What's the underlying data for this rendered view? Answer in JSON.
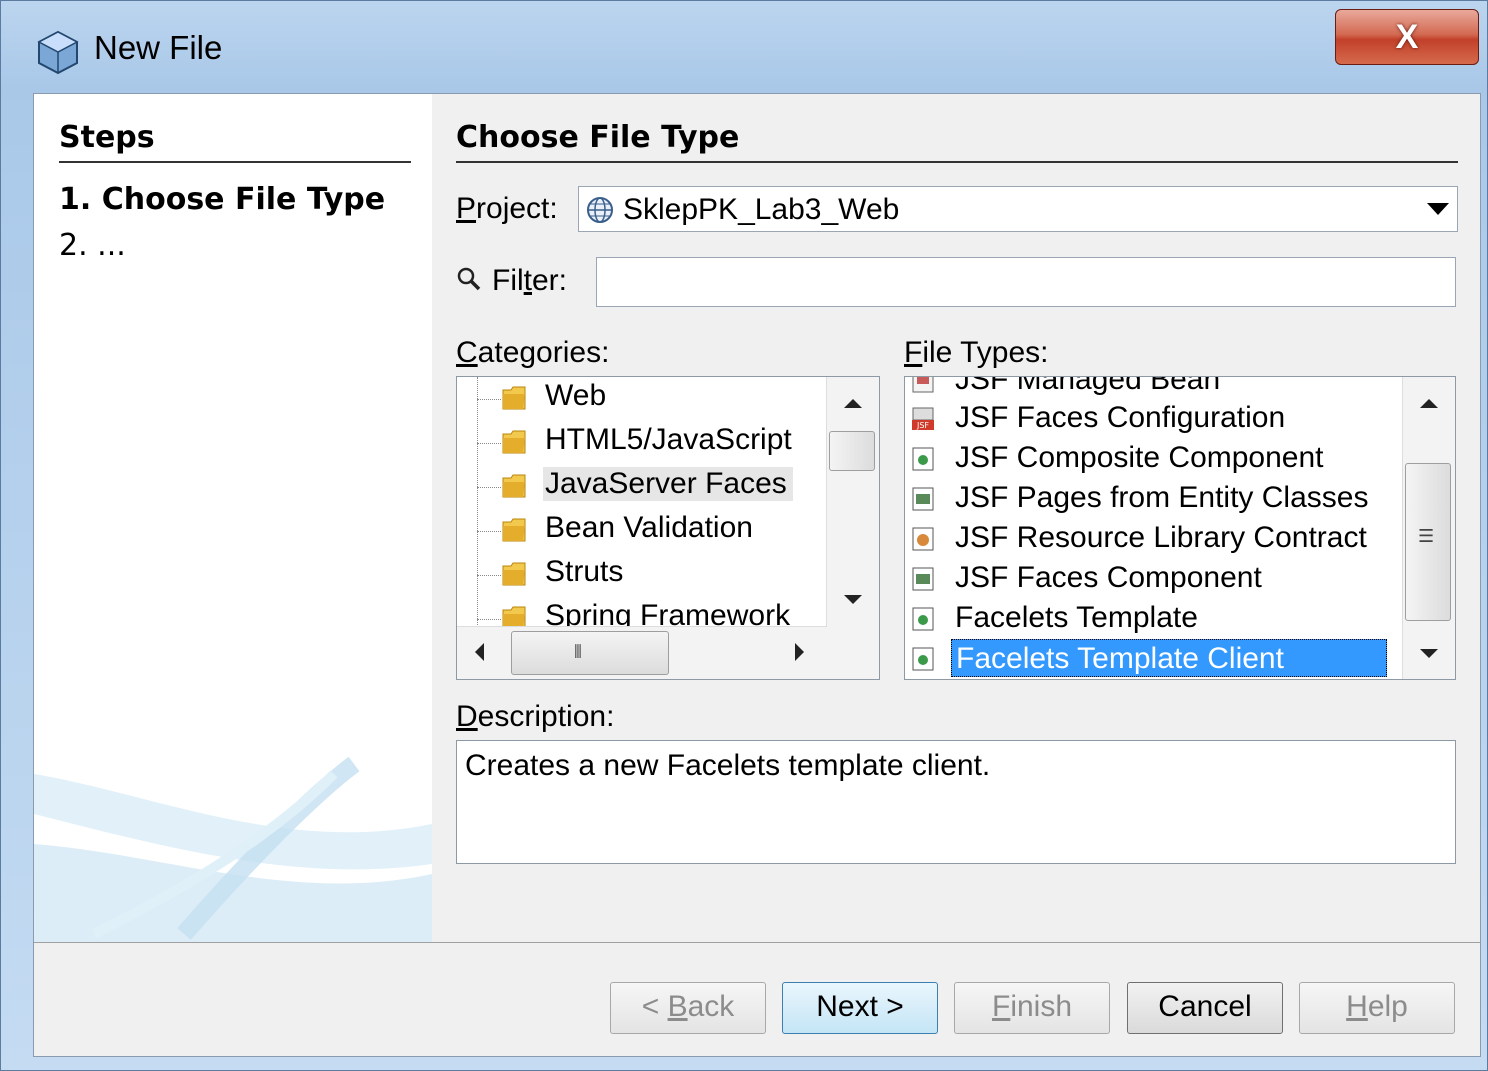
{
  "window": {
    "title": "New File",
    "close_label": "X"
  },
  "steps": {
    "heading": "Steps",
    "items": [
      {
        "num": "1.",
        "label": "Choose File Type"
      },
      {
        "num": "2.",
        "label": "..."
      }
    ]
  },
  "main": {
    "title": "Choose File Type",
    "project": {
      "label_prefix": "",
      "label_mnemonic": "P",
      "label_rest": "roject:",
      "value": "SklepPK_Lab3_Web"
    },
    "filter": {
      "label_pre": "Fil",
      "label_mnemonic": "t",
      "label_rest": "er:",
      "value": ""
    },
    "categories": {
      "label_mnemonic": "C",
      "label_rest": "ategories:",
      "items": [
        "Web",
        "HTML5/JavaScript",
        "JavaServer Faces",
        "Bean Validation",
        "Struts",
        "Spring Framework"
      ],
      "selected": "JavaServer Faces"
    },
    "file_types": {
      "label_mnemonic": "F",
      "label_rest": "ile Types:",
      "items": [
        "JSF Managed Bean",
        "JSF Faces Configuration",
        "JSF Composite Component",
        "JSF Pages from Entity Classes",
        "JSF Resource Library Contract",
        "JSF Faces Component",
        "Facelets Template",
        "Facelets Template Client"
      ],
      "selected": "Facelets Template Client"
    },
    "description": {
      "label_mnemonic": "D",
      "label_rest": "escription:",
      "text": "Creates a new Facelets template client."
    }
  },
  "buttons": {
    "back": {
      "pre": "< ",
      "mnemonic": "B",
      "rest": "ack"
    },
    "next": "Next >",
    "finish": {
      "mnemonic": "F",
      "rest": "inish"
    },
    "cancel": "Cancel",
    "help": {
      "mnemonic": "H",
      "rest": "elp"
    }
  },
  "colors": {
    "selection": "#3399ff",
    "title_bar": "#bcd5ef",
    "close_button": "#c2402a"
  }
}
